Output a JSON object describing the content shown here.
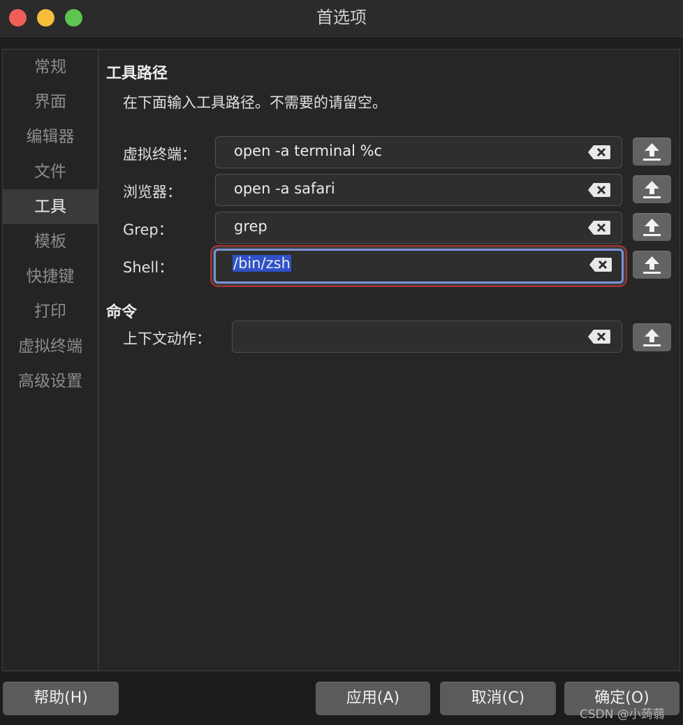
{
  "window": {
    "title": "首选项"
  },
  "sidebar": {
    "items": [
      {
        "label": "常规",
        "active": false
      },
      {
        "label": "界面",
        "active": false
      },
      {
        "label": "编辑器",
        "active": false
      },
      {
        "label": "文件",
        "active": false
      },
      {
        "label": "工具",
        "active": true
      },
      {
        "label": "模板",
        "active": false
      },
      {
        "label": "快捷键",
        "active": false
      },
      {
        "label": "打印",
        "active": false
      },
      {
        "label": "虚拟终端",
        "active": false
      },
      {
        "label": "高级设置",
        "active": false
      }
    ]
  },
  "tools": {
    "heading": "工具路径",
    "description": "在下面输入工具路径。不需要的请留空。",
    "fields": [
      {
        "label": "虚拟终端：",
        "value": "open -a terminal %c"
      },
      {
        "label": "浏览器：",
        "value": "open -a safari"
      },
      {
        "label": "Grep：",
        "value": "grep"
      },
      {
        "label": "Shell：",
        "value": "/bin/zsh",
        "focused": true,
        "selected": true
      }
    ]
  },
  "commands": {
    "heading": "命令",
    "fields": [
      {
        "label": "上下文动作：",
        "value": ""
      }
    ]
  },
  "icons": {
    "clear": "clear-backspace-icon",
    "browse": "upload-arrow-icon"
  },
  "footer": {
    "help_label": "帮助(H)",
    "apply_label": "应用(A)",
    "cancel_label": "取消(C)",
    "ok_label": "确定(O)"
  },
  "watermark": "CSDN @小蒟蒻"
}
